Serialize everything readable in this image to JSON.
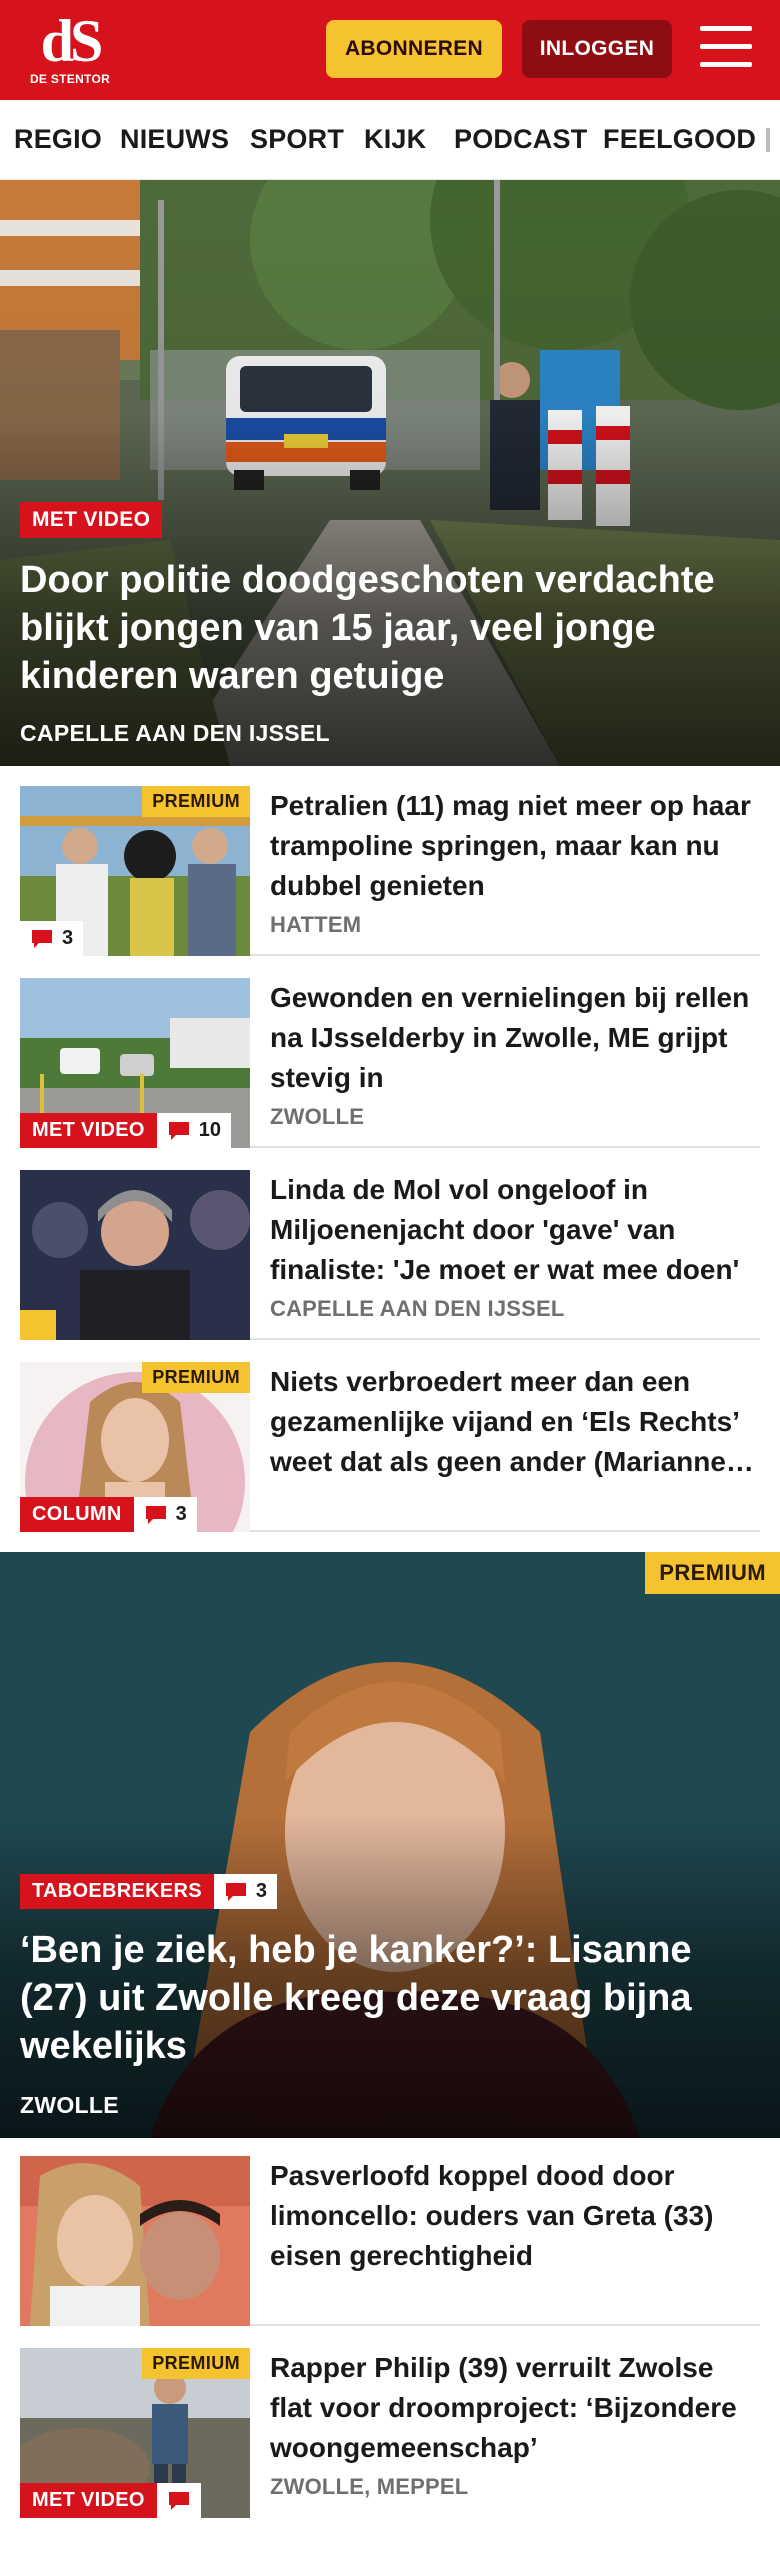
{
  "header": {
    "logo_text": "dS",
    "logo_subtitle": "DE STENTOR",
    "subscribe_label": "ABONNEREN",
    "login_label": "INLOGGEN",
    "menu_icon": "hamburger-menu-icon",
    "brand_red": "#d6121c",
    "accent_yellow": "#f5c230"
  },
  "nav": {
    "items": [
      "REGIO",
      "NIEUWS",
      "SPORT",
      "KIJK",
      "PODCAST",
      "FEELGOOD"
    ]
  },
  "hero": {
    "label": "MET VIDEO",
    "title": "Door politie doodgeschoten verdachte blijkt jongen van 15 jaar, veel jonge kinderen waren getuige",
    "location": "CAPELLE AAN DEN IJSSEL"
  },
  "articles": [
    {
      "premium": "PREMIUM",
      "comments": "3",
      "title": "Petralien (11) mag niet meer op haar trampoline springen, maar kan nu dubbel genieten",
      "location": "HATTEM"
    },
    {
      "label": "MET VIDEO",
      "comments": "10",
      "title": "Gewonden en vernielingen bij rellen na IJsselderby in Zwolle, ME grijpt stevig in",
      "location": "ZWOLLE"
    },
    {
      "title": "Linda de Mol vol ongeloof in Miljoenenjacht door 'gave' van finaliste: 'Je moet er wat mee doen'",
      "location": "CAPELLE AAN DEN IJSSEL"
    },
    {
      "premium": "PREMIUM",
      "label": "COLUMN",
      "comments": "3",
      "title": "Niets verbroedert meer dan een gezamenlijke vijand en ‘Els Rechts’ weet dat als geen ander (Marianne Zwagerman)"
    }
  ],
  "feature": {
    "premium": "PREMIUM",
    "label": "TABOEBREKERS",
    "comments": "3",
    "title": "‘Ben je ziek, heb je kanker?’: Lisanne (27) uit Zwolle kreeg deze vraag bijna wekelijks",
    "location": "ZWOLLE"
  },
  "articles2": [
    {
      "title": "Pasverloofd koppel dood door limoncello: ouders van Greta (33) eisen gerechtigheid"
    },
    {
      "premium": "PREMIUM",
      "label": "MET VIDEO",
      "title": "Rapper Philip (39) verruilt Zwolse flat voor droomproject: ‘Bijzondere woongemeenschap’",
      "location": "ZWOLLE, MEPPEL"
    }
  ]
}
